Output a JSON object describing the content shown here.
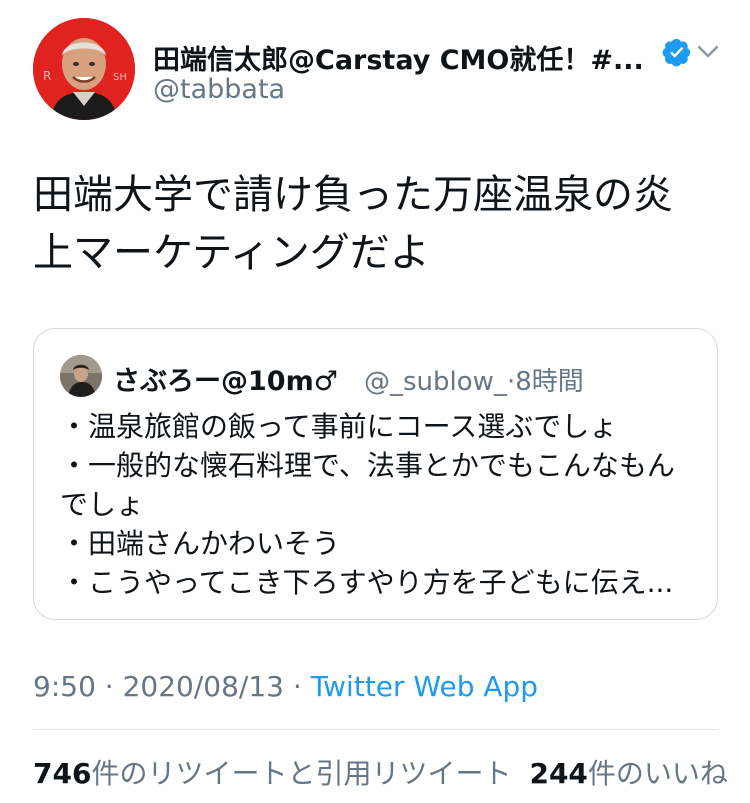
{
  "author": {
    "display_name": "田端信太郎@Carstay CMO就任！#...",
    "handle": "@tabbata",
    "verified": true,
    "avatar_icon": "profile-photo"
  },
  "tweet": {
    "text_line1": "田端大学で請け負った万座温泉の炎",
    "text_line2": "上マーケティングだよ"
  },
  "quoted": {
    "display_name": "さぶろー@10m♂",
    "handle": "@_sublow_",
    "separator": "·",
    "time": "8時間",
    "lines": [
      "・温泉旅館の飯って事前にコース選ぶでしょ",
      "・一般的な懐石料理で、法事とかでもこんなもん",
      "でしょ",
      "・田端さんかわいそう",
      "・こうやってこき下ろすやり方を子どもに伝え..."
    ]
  },
  "meta": {
    "time": "9:50",
    "sep1": " · ",
    "date": "2020/08/13",
    "sep2": " · ",
    "source": "Twitter Web App"
  },
  "stats": {
    "retweets_count": "746",
    "retweets_label": "件のリツイートと引用リツイート",
    "likes_count": "244",
    "likes_label": "件のいいね"
  },
  "colors": {
    "text": "#0f1419",
    "secondary": "#657786",
    "link": "#1d9bf0",
    "border": "#cfd9de",
    "avatar_bg": "#e1231f"
  }
}
